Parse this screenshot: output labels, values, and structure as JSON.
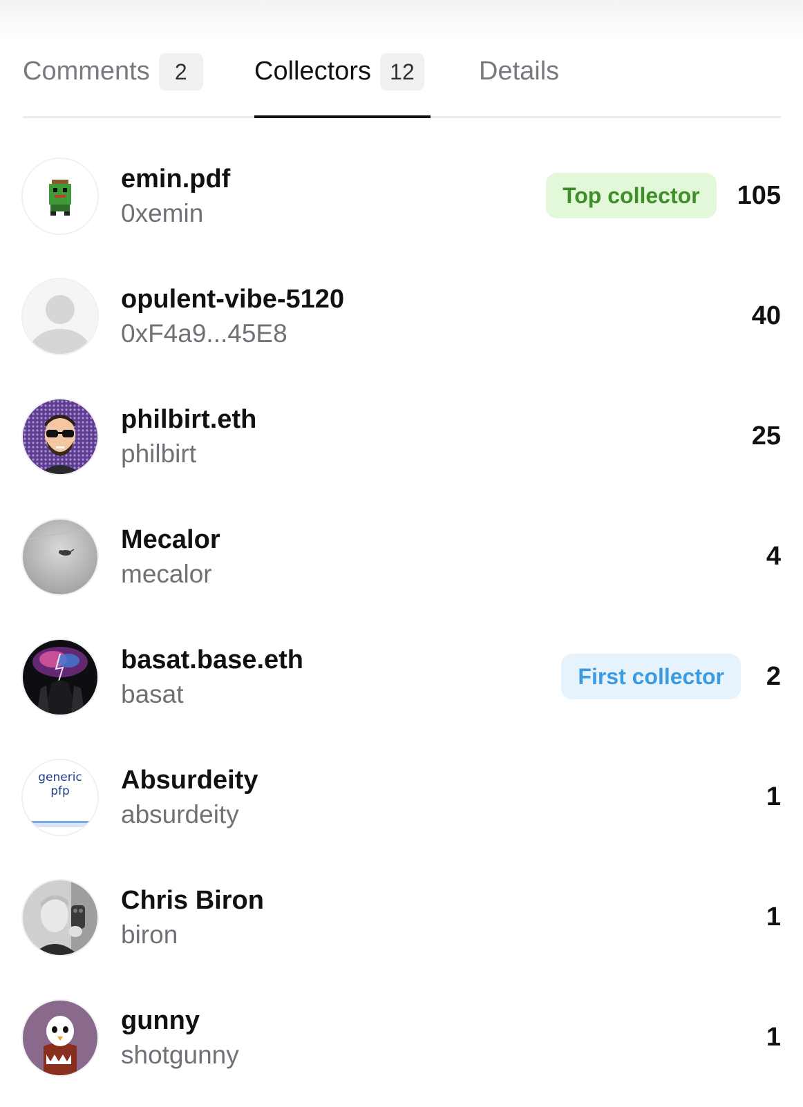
{
  "tabs": [
    {
      "label": "Comments",
      "count": "2",
      "active": false
    },
    {
      "label": "Collectors",
      "count": "12",
      "active": true
    },
    {
      "label": "Details",
      "count": null,
      "active": false
    }
  ],
  "collectors": [
    {
      "name": "emin.pdf",
      "handle": "0xemin",
      "badge": "Top collector",
      "count": "105",
      "avatar": "pixel-robot-icon"
    },
    {
      "name": "opulent-vibe-5120",
      "handle": "0xF4a9...45E8",
      "badge": null,
      "count": "40",
      "avatar": "default-user-icon"
    },
    {
      "name": "philbirt.eth",
      "handle": "philbirt",
      "badge": null,
      "count": "25",
      "avatar": "bearded-man-sunglasses-icon"
    },
    {
      "name": "Mecalor",
      "handle": "mecalor",
      "badge": null,
      "count": "4",
      "avatar": "cat-photo-icon"
    },
    {
      "name": "basat.base.eth",
      "handle": "basat",
      "badge": "First collector",
      "count": "2",
      "avatar": "lightning-art-icon"
    },
    {
      "name": "Absurdeity",
      "handle": "absurdeity",
      "badge": null,
      "count": "1",
      "avatar": "generic-pfp-icon",
      "avatar_text": [
        "generic",
        "pfp"
      ]
    },
    {
      "name": "Chris Biron",
      "handle": "biron",
      "badge": null,
      "count": "1",
      "avatar": "person-photo-icon"
    },
    {
      "name": "gunny",
      "handle": "shotgunny",
      "badge": null,
      "count": "1",
      "avatar": "penguin-monster-icon"
    }
  ],
  "colors": {
    "top_badge_bg": "#e2f8d8",
    "top_badge_text": "#3e8f2a",
    "first_badge_bg": "#e6f3fc",
    "first_badge_text": "#3c9be0"
  }
}
